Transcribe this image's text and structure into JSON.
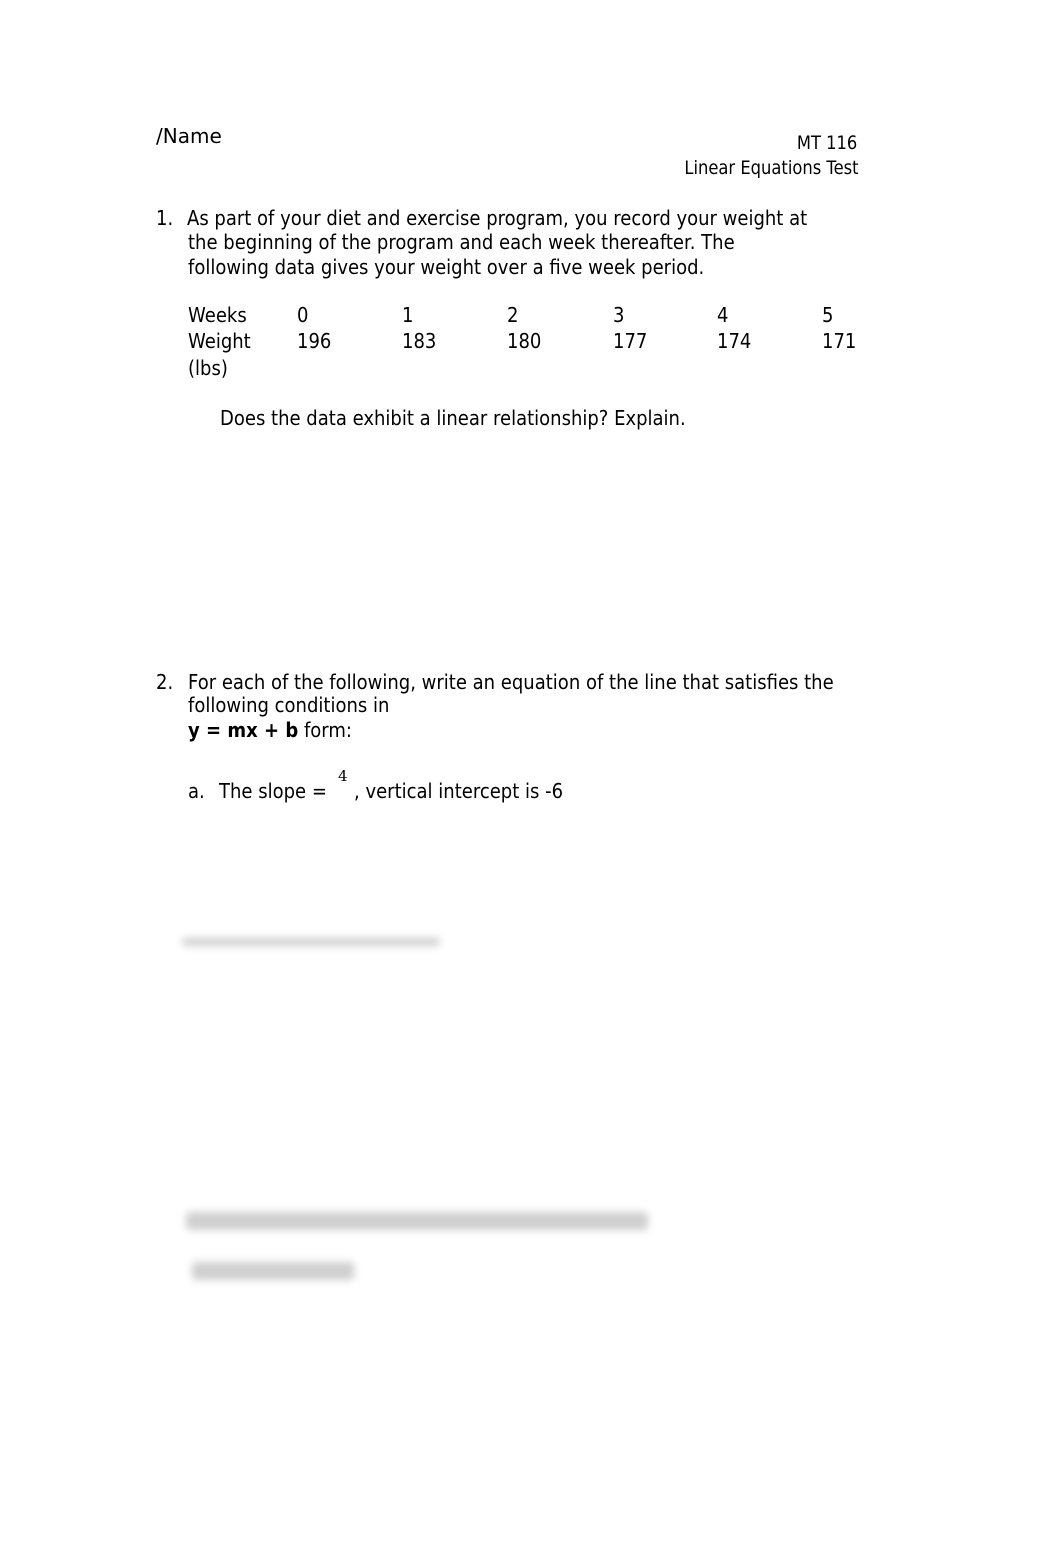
{
  "header": {
    "name_label": "/Name",
    "course": "MT 116",
    "test_title": "Linear Equations Test"
  },
  "question1": {
    "number": "1.",
    "text_lines": [
      "As part of your diet and exercise program, you record your weight at",
      "the beginning of the program and each week thereafter. The",
      "following data gives your weight over a five week period."
    ],
    "table": {
      "row_labels": [
        "Weeks",
        "Weight",
        "(lbs)"
      ],
      "weeks": [
        "0",
        "1",
        "2",
        "3",
        "4",
        "5"
      ],
      "weights": [
        "196",
        "183",
        "180",
        "177",
        "174",
        "171"
      ]
    },
    "prompt": "Does the data exhibit a linear relationship? Explain."
  },
  "question2": {
    "number": "2.",
    "text_lines": [
      "For each of the following, write an equation of the line that satisfies the",
      "following conditions in"
    ],
    "form_bold": "y = mx + b",
    "form_suffix": " form:",
    "part_a": {
      "label": "a.",
      "prefix": "The slope = ",
      "slope_numerator": "4",
      "suffix": ", vertical intercept is -6"
    }
  }
}
